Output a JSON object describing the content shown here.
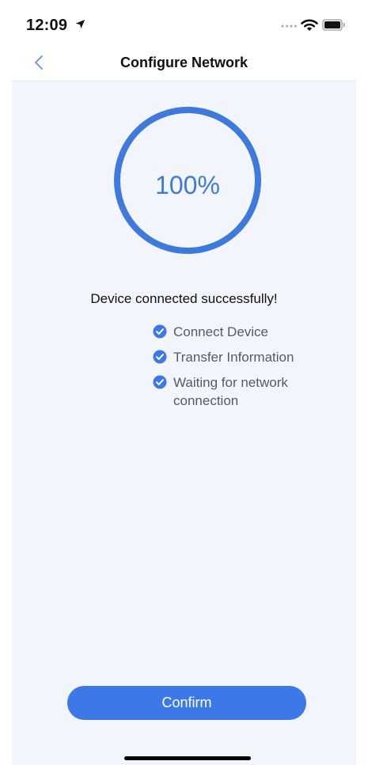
{
  "status_bar": {
    "time": "12:09",
    "icons": [
      "location-arrow-icon",
      "signal-dots-icon",
      "wifi-icon",
      "battery-icon"
    ]
  },
  "nav": {
    "title": "Configure Network",
    "back_icon": "chevron-left-icon"
  },
  "progress": {
    "value": 1,
    "text": "100%"
  },
  "status_message": "Device connected successfully!",
  "steps": [
    {
      "label": "Connect Device",
      "icon": "check-circle-icon"
    },
    {
      "label": "Transfer Information",
      "icon": "check-circle-icon"
    },
    {
      "label": "Waiting for network connection",
      "icon": "check-circle-icon"
    }
  ],
  "button": {
    "label": "Confirm"
  },
  "colors": {
    "accent": "#3d79e6",
    "progress_text": "#3e79dc",
    "background": "#f3f5fc",
    "step_text": "#555a65"
  }
}
